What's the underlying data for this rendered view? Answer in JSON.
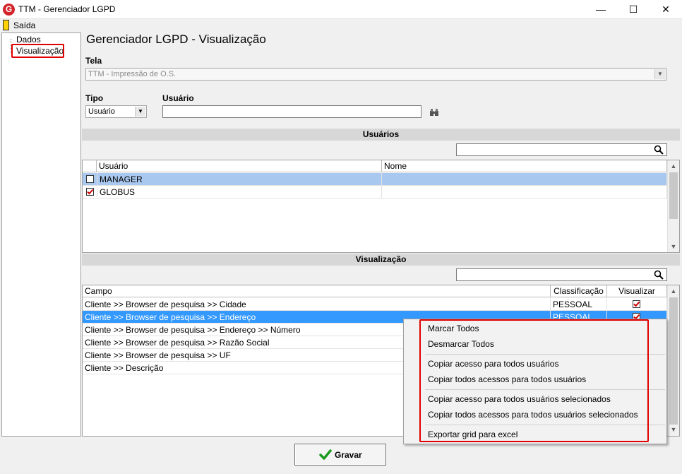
{
  "window": {
    "title": "TTM - Gerenciador LGPD",
    "app_icon": "G",
    "minimize_glyph": "—",
    "maximize_glyph": "☐",
    "close_glyph": "✕"
  },
  "menu": {
    "exit_label": "Saída"
  },
  "tree": {
    "items": [
      "Dados",
      "Visualização"
    ]
  },
  "page_title": "Gerenciador LGPD - Visualização",
  "tela": {
    "label": "Tela",
    "value": "TTM - Impressão de O.S."
  },
  "tipo": {
    "label": "Tipo",
    "value": "Usuário"
  },
  "usuario": {
    "label": "Usuário",
    "value": ""
  },
  "users_section": {
    "title": "Usuários",
    "search_value": "",
    "columns": [
      "Usuário",
      "Nome"
    ],
    "rows": [
      {
        "user": "MANAGER",
        "name": "",
        "checked": false
      },
      {
        "user": "GLOBUS",
        "name": "",
        "checked": true
      }
    ]
  },
  "view_section": {
    "title": "Visualização",
    "search_value": "",
    "columns": [
      "Campo",
      "Classificação",
      "Visualizar"
    ],
    "rows": [
      {
        "campo": "Cliente >> Browser de pesquisa >> Cidade",
        "class": "PESSOAL",
        "view": true
      },
      {
        "campo": "Cliente >> Browser de pesquisa >> Endereço",
        "class": "PESSOAL",
        "view": true
      },
      {
        "campo": "Cliente >> Browser de pesquisa >> Endereço >> Número",
        "class": "",
        "view": false
      },
      {
        "campo": "Cliente >> Browser de pesquisa >> Razão Social",
        "class": "",
        "view": false
      },
      {
        "campo": "Cliente >> Browser de pesquisa >> UF",
        "class": "",
        "view": false
      },
      {
        "campo": "Cliente >> Descrição",
        "class": "",
        "view": false
      }
    ]
  },
  "context_menu": {
    "items": [
      "Marcar Todos",
      "Desmarcar Todos",
      "Copiar acesso para todos usuários",
      "Copiar todos acessos para todos usuários",
      "Copiar acesso para todos usuários selecionados",
      "Copiar todos acessos para todos usuários selecionados",
      "Exportar grid para excel"
    ]
  },
  "save_button": {
    "label": "Gravar"
  },
  "colors": {
    "accent_red": "#e00000",
    "selection_blue": "#3399ff",
    "check_red": "#cc0000"
  }
}
